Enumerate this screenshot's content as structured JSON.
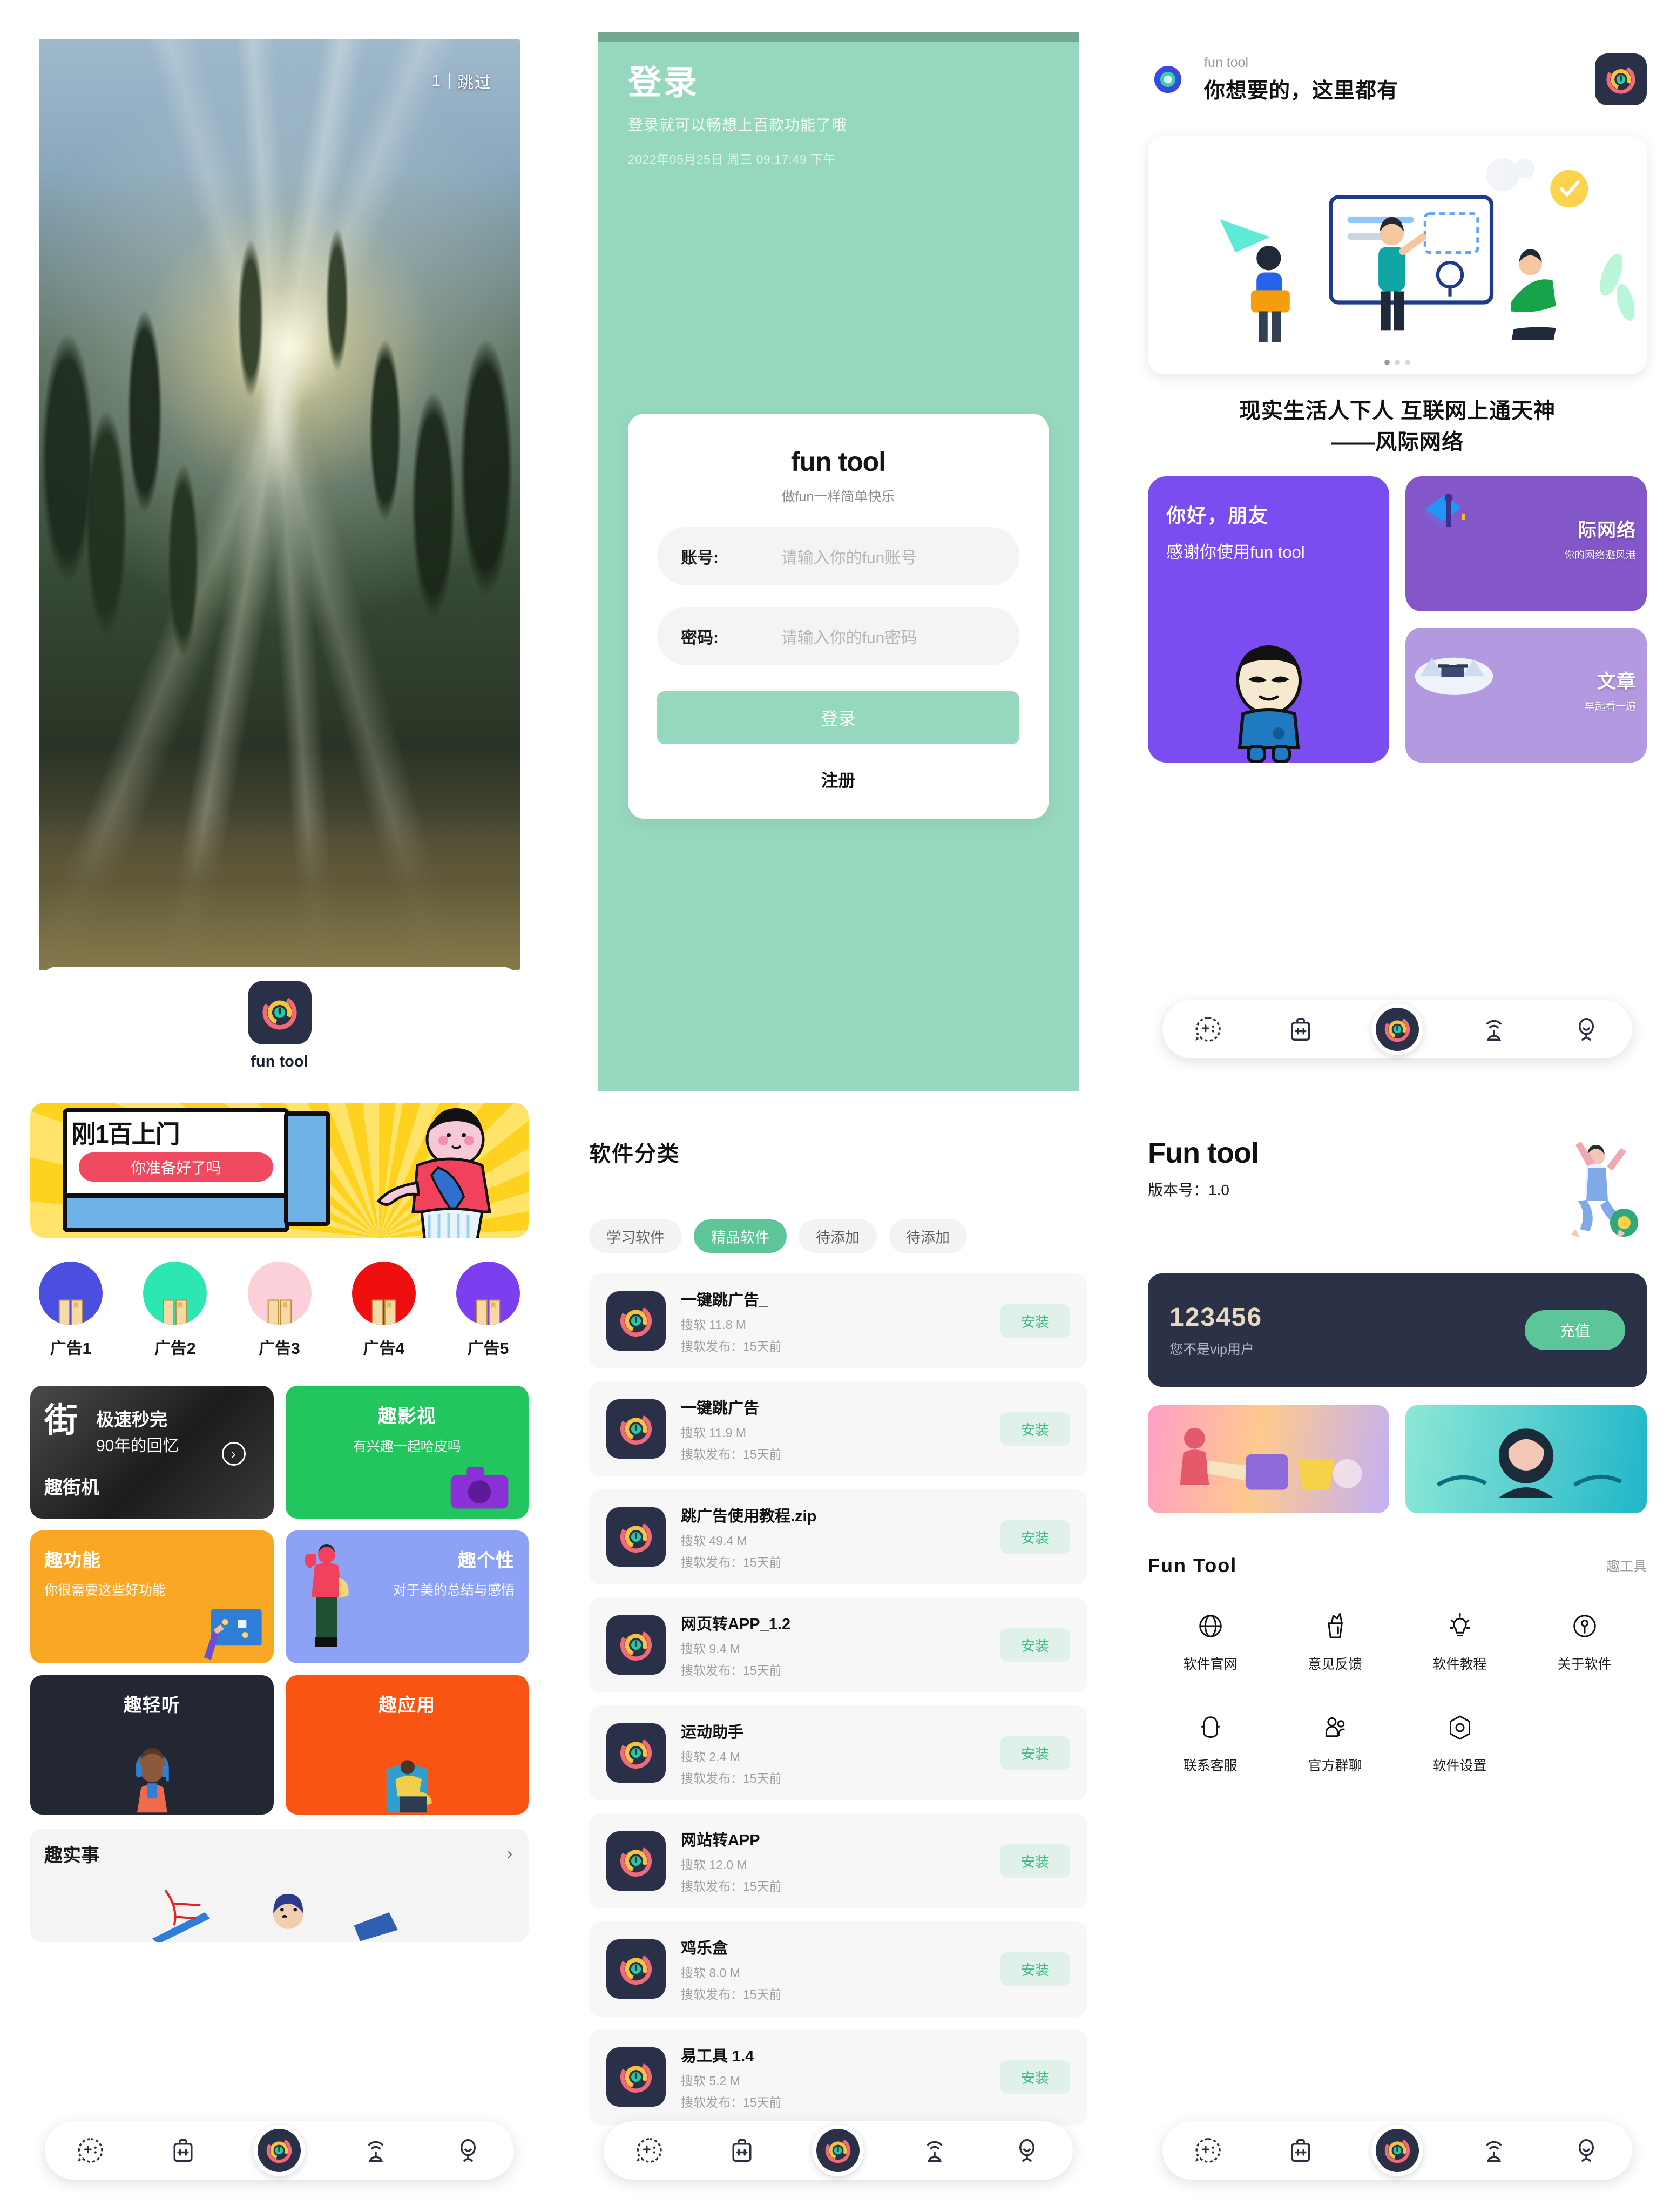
{
  "app": {
    "name": "fun tool",
    "logo_name": "fun-tool-logo"
  },
  "colors": {
    "mint": "#96d8bd",
    "green_accent": "#5cc698",
    "install_bg": "#dff1e8",
    "install_text": "#3fb98b",
    "dark_navy": "#2b3146",
    "purple": "#7b4df0"
  },
  "splash": {
    "skip_counter": "1",
    "skip_label": "跳过",
    "app_name": "fun tool"
  },
  "login": {
    "title": "登录",
    "subtitle": "登录就可以畅想上百款功能了哦",
    "datetime": "2022年05月25日 周三 09:17:49 下午",
    "brand": "fun tool",
    "slogan": "做fun一样简单快乐",
    "fields": [
      {
        "label": "账号:",
        "placeholder": "请输入你的fun账号"
      },
      {
        "label": "密码:",
        "placeholder": "请输入你的fun密码"
      }
    ],
    "login_button": "登录",
    "register_link": "注册"
  },
  "home": {
    "header": {
      "small": "fun tool",
      "big": "你想要的，这里都有"
    },
    "slogan_line1": "现实生活人下人 互联网上通天神",
    "slogan_line2": "——风际网络",
    "cards": {
      "hello": {
        "line1": "你好，朋友",
        "line2": "感谢你使用fun tool"
      },
      "network": {
        "title": "际网络",
        "sub": "你的网络避风港"
      },
      "article": {
        "title": "文章",
        "sub": "早起看一遍"
      }
    }
  },
  "category_page": {
    "promo": {
      "headline": "刚1百上门",
      "pill": "你准备好了吗"
    },
    "ads": [
      {
        "label": "广告1",
        "color": "#4b4fe0"
      },
      {
        "label": "广告2",
        "color": "#2ce8b0"
      },
      {
        "label": "广告3",
        "color": "#fbd0d8"
      },
      {
        "label": "广告4",
        "color": "#ef0f0f"
      },
      {
        "label": "广告5",
        "color": "#7b3ef0"
      }
    ],
    "tiles": [
      {
        "char": "街",
        "title": "极速秒完",
        "sub": "90年的回忆",
        "name": "趣街机"
      },
      {
        "title": "趣影视",
        "sub": "有兴趣一起哈皮吗"
      },
      {
        "title": "趣功能",
        "sub": "你很需要这些好功能"
      },
      {
        "title": "趣个性",
        "sub": "对于美的总结与感悟"
      },
      {
        "title": "趣轻听"
      },
      {
        "title": "趣应用"
      }
    ],
    "last_row": {
      "title": "趣实事"
    }
  },
  "software_page": {
    "title": "软件分类",
    "tabs": [
      {
        "label": "学习软件",
        "active": false
      },
      {
        "label": "精品软件",
        "active": true
      },
      {
        "label": "待添加",
        "active": false
      },
      {
        "label": "待添加",
        "active": false
      }
    ],
    "install_label": "安装",
    "apps": [
      {
        "name": "一键跳广告_",
        "size": "搜软 11.8 M",
        "date": "搜软发布：15天前"
      },
      {
        "name": "一键跳广告",
        "size": "搜软 11.9 M",
        "date": "搜软发布：15天前"
      },
      {
        "name": "跳广告使用教程.zip",
        "size": "搜软 49.4 M",
        "date": "搜软发布：15天前"
      },
      {
        "name": "网页转APP_1.2",
        "size": "搜软 9.4 M",
        "date": "搜软发布：15天前"
      },
      {
        "name": "运动助手",
        "size": "搜软 2.4 M",
        "date": "搜软发布：15天前"
      },
      {
        "name": "网站转APP",
        "size": "搜软 12.0 M",
        "date": "搜软发布：15天前"
      },
      {
        "name": "鸡乐盒",
        "size": "搜软 8.0 M",
        "date": "搜软发布：15天前"
      },
      {
        "name": "易工具 1.4",
        "size": "搜软 5.2 M",
        "date": "搜软发布：15天前"
      }
    ]
  },
  "profile_page": {
    "title": "Fun tool",
    "version": "版本号：1.0",
    "vip": {
      "account": "123456",
      "note": "您不是vip用户",
      "button": "充值"
    },
    "section": {
      "title": "Fun Tool",
      "more": "趣工具"
    },
    "items": [
      {
        "label": "软件官网",
        "icon": "globe-icon"
      },
      {
        "label": "意见反馈",
        "icon": "feedback-icon"
      },
      {
        "label": "软件教程",
        "icon": "bulb-icon"
      },
      {
        "label": "关于软件",
        "icon": "info-shield-icon"
      },
      {
        "label": "联系客服",
        "icon": "headset-icon"
      },
      {
        "label": "官方群聊",
        "icon": "people-icon"
      },
      {
        "label": "软件设置",
        "icon": "settings-icon"
      }
    ]
  },
  "tabbar": {
    "items": [
      {
        "name": "game-tab",
        "icon": "emoji-game-icon"
      },
      {
        "name": "toolbox-tab",
        "icon": "toolbox-icon"
      },
      {
        "name": "home-tab",
        "icon": "fun-tool-logo"
      },
      {
        "name": "discover-tab",
        "icon": "radar-icon"
      },
      {
        "name": "profile-tab",
        "icon": "person-icon"
      }
    ]
  }
}
